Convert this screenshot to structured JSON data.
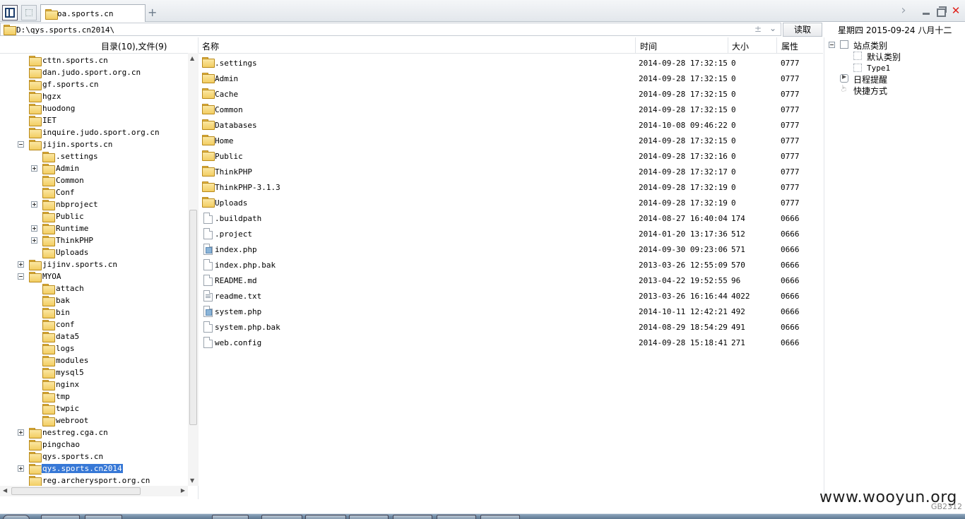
{
  "window": {
    "tab_title": "oa.sports.cn",
    "new_tab_symbol": "+",
    "close_symbol": "✕",
    "forward_symbol": "›"
  },
  "address": {
    "path": "D:\\qys.sports.cn2014\\",
    "read_button": "读取",
    "date_text": "星期四 2015-09-24 八月十二",
    "star_symbol": "±",
    "dropdown_symbol": "⌄"
  },
  "tree": {
    "header": "目录(10),文件(9)",
    "items": [
      {
        "label": "cttn.sports.cn",
        "level": 1,
        "exp": ""
      },
      {
        "label": "dan.judo.sport.org.cn",
        "level": 1,
        "exp": ""
      },
      {
        "label": "gf.sports.cn",
        "level": 1,
        "exp": ""
      },
      {
        "label": "hgzx",
        "level": 1,
        "exp": ""
      },
      {
        "label": "huodong",
        "level": 1,
        "exp": ""
      },
      {
        "label": "IET",
        "level": 1,
        "exp": ""
      },
      {
        "label": "inquire.judo.sport.org.cn",
        "level": 1,
        "exp": ""
      },
      {
        "label": "jijin.sports.cn",
        "level": 1,
        "exp": "minus"
      },
      {
        "label": ".settings",
        "level": 2,
        "exp": ""
      },
      {
        "label": "Admin",
        "level": 2,
        "exp": "plus"
      },
      {
        "label": "Common",
        "level": 2,
        "exp": ""
      },
      {
        "label": "Conf",
        "level": 2,
        "exp": ""
      },
      {
        "label": "nbproject",
        "level": 2,
        "exp": "plus"
      },
      {
        "label": "Public",
        "level": 2,
        "exp": ""
      },
      {
        "label": "Runtime",
        "level": 2,
        "exp": "plus"
      },
      {
        "label": "ThinkPHP",
        "level": 2,
        "exp": "plus"
      },
      {
        "label": "Uploads",
        "level": 2,
        "exp": ""
      },
      {
        "label": "jijinv.sports.cn",
        "level": 1,
        "exp": "plus"
      },
      {
        "label": "MYOA",
        "level": 1,
        "exp": "minus"
      },
      {
        "label": "attach",
        "level": 2,
        "exp": ""
      },
      {
        "label": "bak",
        "level": 2,
        "exp": ""
      },
      {
        "label": "bin",
        "level": 2,
        "exp": ""
      },
      {
        "label": "conf",
        "level": 2,
        "exp": ""
      },
      {
        "label": "data5",
        "level": 2,
        "exp": ""
      },
      {
        "label": "logs",
        "level": 2,
        "exp": ""
      },
      {
        "label": "modules",
        "level": 2,
        "exp": ""
      },
      {
        "label": "mysql5",
        "level": 2,
        "exp": ""
      },
      {
        "label": "nginx",
        "level": 2,
        "exp": ""
      },
      {
        "label": "tmp",
        "level": 2,
        "exp": ""
      },
      {
        "label": "twpic",
        "level": 2,
        "exp": ""
      },
      {
        "label": "webroot",
        "level": 2,
        "exp": ""
      },
      {
        "label": "nestreg.cga.cn",
        "level": 1,
        "exp": "plus"
      },
      {
        "label": "pingchao",
        "level": 1,
        "exp": ""
      },
      {
        "label": "qys.sports.cn",
        "level": 1,
        "exp": ""
      },
      {
        "label": "qys.sports.cn2014",
        "level": 1,
        "exp": "plus",
        "selected": true
      },
      {
        "label": "reg.archerysport.org.cn",
        "level": 1,
        "exp": ""
      }
    ]
  },
  "files": {
    "columns": {
      "name": "名称",
      "time": "时间",
      "size": "大小",
      "attr": "属性"
    },
    "rows": [
      {
        "name": ".settings",
        "time": "2014-09-28 17:32:15",
        "size": "0",
        "attr": "0777",
        "kind": "folder"
      },
      {
        "name": "Admin",
        "time": "2014-09-28 17:32:15",
        "size": "0",
        "attr": "0777",
        "kind": "folder"
      },
      {
        "name": "Cache",
        "time": "2014-09-28 17:32:15",
        "size": "0",
        "attr": "0777",
        "kind": "folder"
      },
      {
        "name": "Common",
        "time": "2014-09-28 17:32:15",
        "size": "0",
        "attr": "0777",
        "kind": "folder"
      },
      {
        "name": "Databases",
        "time": "2014-10-08 09:46:22",
        "size": "0",
        "attr": "0777",
        "kind": "folder"
      },
      {
        "name": "Home",
        "time": "2014-09-28 17:32:15",
        "size": "0",
        "attr": "0777",
        "kind": "folder"
      },
      {
        "name": "Public",
        "time": "2014-09-28 17:32:16",
        "size": "0",
        "attr": "0777",
        "kind": "folder"
      },
      {
        "name": "ThinkPHP",
        "time": "2014-09-28 17:32:17",
        "size": "0",
        "attr": "0777",
        "kind": "folder"
      },
      {
        "name": "ThinkPHP-3.1.3",
        "time": "2014-09-28 17:32:19",
        "size": "0",
        "attr": "0777",
        "kind": "folder"
      },
      {
        "name": "Uploads",
        "time": "2014-09-28 17:32:19",
        "size": "0",
        "attr": "0777",
        "kind": "folder"
      },
      {
        "name": ".buildpath",
        "time": "2014-08-27 16:40:04",
        "size": "174",
        "attr": "0666",
        "kind": "file"
      },
      {
        "name": ".project",
        "time": "2014-01-20 13:17:36",
        "size": "512",
        "attr": "0666",
        "kind": "file"
      },
      {
        "name": "index.php",
        "time": "2014-09-30 09:23:06",
        "size": "571",
        "attr": "0666",
        "kind": "script"
      },
      {
        "name": "index.php.bak",
        "time": "2013-03-26 12:55:09",
        "size": "570",
        "attr": "0666",
        "kind": "file"
      },
      {
        "name": "README.md",
        "time": "2013-04-22 19:52:55",
        "size": "96",
        "attr": "0666",
        "kind": "file"
      },
      {
        "name": "readme.txt",
        "time": "2013-03-26 16:16:44",
        "size": "4022",
        "attr": "0666",
        "kind": "text"
      },
      {
        "name": "system.php",
        "time": "2014-10-11 12:42:21",
        "size": "492",
        "attr": "0666",
        "kind": "script"
      },
      {
        "name": "system.php.bak",
        "time": "2014-08-29 18:54:29",
        "size": "491",
        "attr": "0666",
        "kind": "file"
      },
      {
        "name": "web.config",
        "time": "2014-09-28 15:18:41",
        "size": "271",
        "attr": "0666",
        "kind": "file"
      }
    ]
  },
  "side": {
    "site_categories": "站点类别",
    "default_category": "默认类别",
    "type1": "Type1",
    "schedule": "日程提醒",
    "shortcuts": "快捷方式"
  },
  "footer": {
    "watermark": "www.wooyun.org",
    "encoding": "GB2312"
  },
  "colors": {
    "selection": "#3778d6",
    "folder": "#f2cd62",
    "close": "#e0201a"
  }
}
